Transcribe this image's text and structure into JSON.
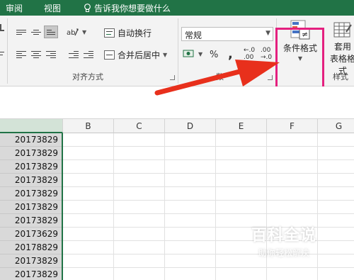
{
  "tabs": {
    "review": "审阅",
    "view": "视图",
    "tell_me": "告诉我你想要做什么"
  },
  "ribbon": {
    "alignment": {
      "wrap_text": "自动换行",
      "merge_center": "合并后居中",
      "group_label": "对齐方式"
    },
    "number": {
      "format_value": "常规",
      "percent": "%",
      "comma": ",",
      "dec_increase": "←.0\n.00",
      "dec_decrease": ".00\n→.0",
      "group_label": "数"
    },
    "styles": {
      "conditional_formatting": "条件格式",
      "format_as_table_line1": "套用",
      "format_as_table_line2": "表格格式",
      "group_label": "样式"
    }
  },
  "grid": {
    "columns": [
      "B",
      "C",
      "D",
      "E",
      "F",
      "G"
    ],
    "column_a_values": [
      "20173829",
      "20173829",
      "20173829",
      "20173829",
      "20173829",
      "20173829",
      "20173829",
      "20173629",
      "20178829",
      "20173829",
      "20173829"
    ]
  },
  "watermark": {
    "title": "百科全说",
    "subtitle": "助你轻松解决"
  },
  "colors": {
    "excel_green": "#217346",
    "highlight_pink": "#e4207f",
    "arrow_red": "#e8301c"
  }
}
